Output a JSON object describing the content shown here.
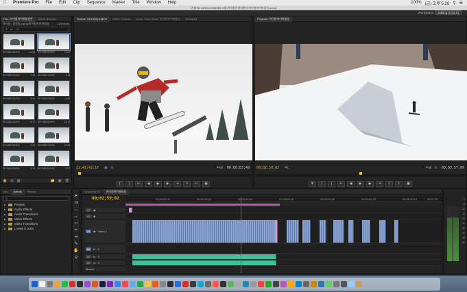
{
  "menubar": {
    "app_name": "Premiere Pro",
    "items": [
      "File",
      "Edit",
      "Clip",
      "Sequence",
      "Marker",
      "Title",
      "Window",
      "Help"
    ],
    "clock": "(금) 오후 5:28",
    "battery": "100%"
  },
  "window_title": "/사용자/HONGKOON/데스크탑/하이원운영일관리/하이원하이워일일.prproj",
  "workspace": {
    "label": "Workspace:",
    "value": "Editing (CS5.5)"
  },
  "project": {
    "tabs": [
      "Pro...하이원하이워일일관",
      "Media Browser"
    ],
    "bin_name": "하이원...일필일.prproj/하이원하이워일일",
    "item_count": "154 Items",
    "in_label": "In:",
    "in_value": "All",
    "clips": [
      {
        "name": "SKY08218.MOV",
        "duration": "11:28",
        "selected": false
      },
      {
        "name": "SKY08219.MOV",
        "duration": "11:13",
        "selected": true
      },
      {
        "name": "SKY08220.MOV",
        "duration": "7:28",
        "selected": false
      },
      {
        "name": "SKY08221.MOV",
        "duration": "1:48",
        "selected": false
      },
      {
        "name": "SKY08222.MOV",
        "duration": "3:26",
        "selected": false
      },
      {
        "name": "SKY08223.MOV",
        "duration": "3:34",
        "selected": false
      },
      {
        "name": "SKY08224.MOV",
        "duration": "5:17",
        "selected": false
      },
      {
        "name": "SKY08225.MOV",
        "duration": "11:13",
        "selected": false
      },
      {
        "name": "SKY08226.MOV",
        "duration": "9:25",
        "selected": false
      },
      {
        "name": "SKY08227.MOV",
        "duration": "10:43",
        "selected": false
      },
      {
        "name": "SKY08228.MOV",
        "duration": "3:13",
        "selected": false
      },
      {
        "name": "SKY08229.MOV",
        "duration": "5:02",
        "selected": false
      }
    ]
  },
  "source": {
    "tabs": [
      "Source: SKY08213.MOV",
      "Effect Controls",
      "Audio Track Mixer: 하이원하이워일일",
      "Metadata"
    ],
    "timecode": "22;41;42;17",
    "fit": "Full",
    "duration": "00;00;03;48"
  },
  "program": {
    "tabs": [
      "Program: 하이원하이워일일"
    ],
    "timecode": "00;02;59;02",
    "fit": "Fit",
    "quality": "Full",
    "duration": "00;03;57;09"
  },
  "effects": {
    "tabs": [
      "Info",
      "Effects",
      "History"
    ],
    "items": [
      "Presets",
      "Audio Effects",
      "Audio Transitions",
      "Video Effects",
      "Video Transitions",
      "Lumetri Looks"
    ]
  },
  "timeline": {
    "tabs": [
      "Sequence 01",
      "하이원하이워일일"
    ],
    "timecode": "00;02;59;02",
    "ruler": [
      "00;00;59;22",
      "00;01;59;21",
      "00;02;59;20",
      "00;03;59;18",
      "00;04;59;16",
      "00;05;59;15",
      "00;06;59;13",
      "00;07;59"
    ],
    "video_tracks": [
      "V3",
      "V2",
      "V1"
    ],
    "audio_tracks": [
      "A1",
      "A2",
      "A3"
    ],
    "v1_label": "Video 1",
    "master": "Master"
  },
  "meter": {
    "scale": [
      "0",
      "-6",
      "-12",
      "-18",
      "-24",
      "-30",
      "-36",
      "-42",
      "-48",
      "-54"
    ]
  }
}
